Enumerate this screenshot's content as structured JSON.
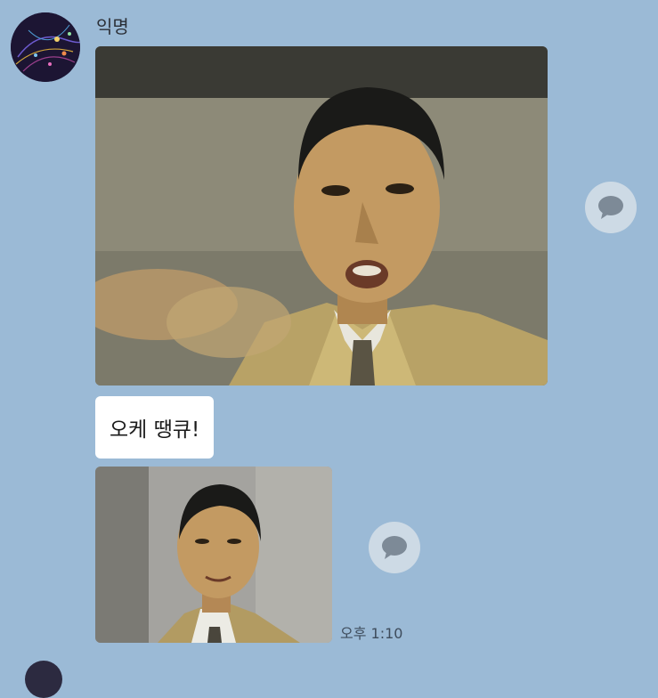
{
  "chat": {
    "sender_name": "익명",
    "messages": [
      {
        "type": "photo",
        "description": ""
      },
      {
        "type": "text",
        "text": "오케 땡큐!"
      },
      {
        "type": "photo"
      }
    ],
    "timestamp": "오후 1:10"
  },
  "icons": {
    "avatar": "profile-avatar",
    "share": "speech-bubble-icon"
  },
  "colors": {
    "background": "#9bbad6",
    "bubble": "#ffffff",
    "share_button": "#d6dfe8",
    "share_icon": "#7d8a97"
  }
}
